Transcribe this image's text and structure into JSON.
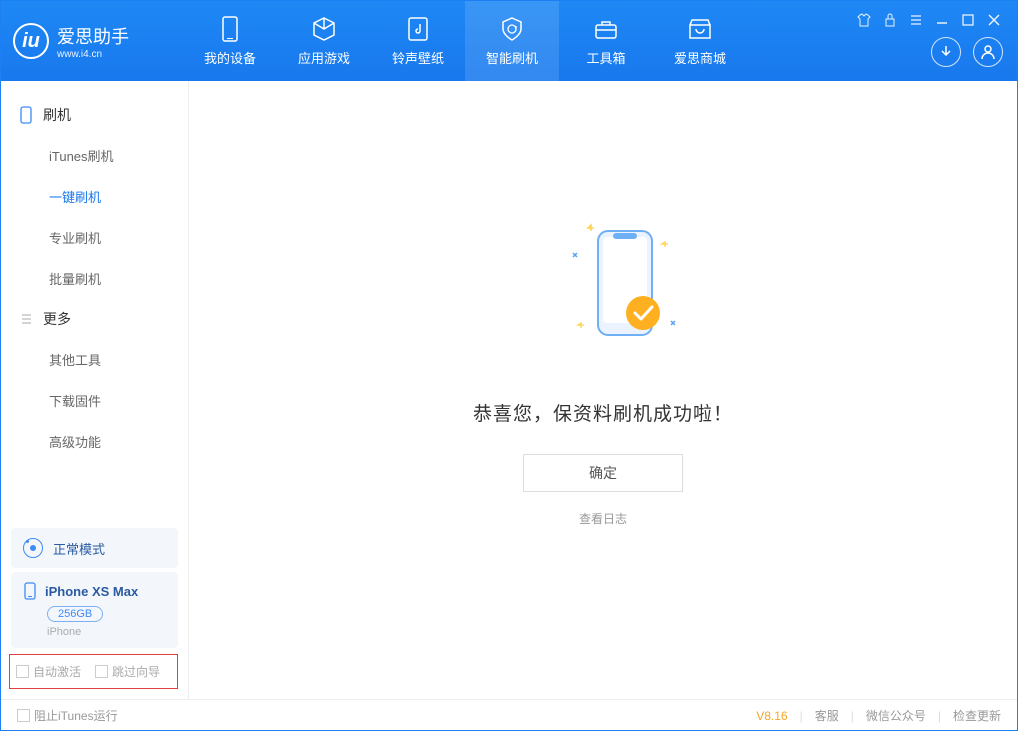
{
  "app": {
    "name": "爱思助手",
    "url": "www.i4.cn"
  },
  "tabs": [
    {
      "label": "我的设备"
    },
    {
      "label": "应用游戏"
    },
    {
      "label": "铃声壁纸"
    },
    {
      "label": "智能刷机"
    },
    {
      "label": "工具箱"
    },
    {
      "label": "爱思商城"
    }
  ],
  "sidebar": {
    "flash": {
      "title": "刷机",
      "items": [
        "iTunes刷机",
        "一键刷机",
        "专业刷机",
        "批量刷机"
      ]
    },
    "more": {
      "title": "更多",
      "items": [
        "其他工具",
        "下载固件",
        "高级功能"
      ]
    }
  },
  "mode": {
    "label": "正常模式"
  },
  "device": {
    "name": "iPhone XS Max",
    "storage": "256GB",
    "type": "iPhone"
  },
  "options": {
    "auto_activate": "自动激活",
    "skip_guide": "跳过向导"
  },
  "main": {
    "success_text": "恭喜您，保资料刷机成功啦！",
    "ok": "确定",
    "view_log": "查看日志"
  },
  "footer": {
    "block_itunes": "阻止iTunes运行",
    "version": "V8.16",
    "links": [
      "客服",
      "微信公众号",
      "检查更新"
    ]
  }
}
